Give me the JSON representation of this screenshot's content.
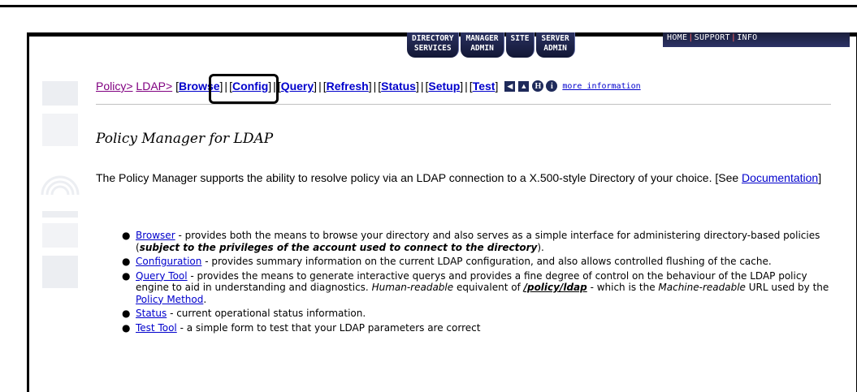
{
  "top_nav": {
    "tabs": [
      {
        "line1": "DIRECTORY",
        "line2": "SERVICES"
      },
      {
        "line1": "MANAGER",
        "line2": "ADMIN"
      },
      {
        "line1": "SITE",
        "line2": ""
      },
      {
        "line1": "SERVER",
        "line2": "ADMIN"
      }
    ],
    "links": [
      "HOME",
      "SUPPORT",
      "INFO"
    ]
  },
  "breadcrumb": {
    "policy": "Policy>",
    "ldap": "LDAP>",
    "items": [
      "Browse",
      "Config",
      "Query",
      "Refresh",
      "Status",
      "Setup",
      "Test"
    ],
    "more": "more information",
    "icons": [
      "arrow-left-icon",
      "arrow-up-icon",
      "help-icon",
      "info-icon"
    ]
  },
  "page": {
    "title": "Policy Manager for LDAP",
    "intro_text": "The Policy Manager supports the ability to resolve policy via an LDAP connection to a X.500-style Directory of your choice. [See ",
    "intro_link": "Documentation",
    "intro_end": "]"
  },
  "features": {
    "browser": {
      "link": "Browser",
      "text": " - provides both the means to browse your directory and also serves as a simple interface for administering directory-based policies (",
      "bold": "subject to the privileges of the account used to connect to the directory",
      "end": ")."
    },
    "configuration": {
      "link": "Configuration",
      "text": " - provides summary information on the current LDAP configuration, and also allows controlled flushing of the cache."
    },
    "query": {
      "link": "Query Tool",
      "text": " - provides the means to generate interactive querys and provides a fine degree of control on the behaviour of the LDAP policy engine to aid in understanding and diagnostics. ",
      "em1": "Human-readable",
      "text2": " equivalent of ",
      "code": "/policy/ldap",
      "text3": " - which is the ",
      "em2": "Machine-readable",
      "text4": " URL used by the ",
      "link2": "Policy Method",
      "end": "."
    },
    "status": {
      "link": "Status",
      "text": " - current operational status information."
    },
    "test": {
      "link": "Test Tool",
      "text": " - a simple form to test that your LDAP parameters are correct"
    }
  }
}
